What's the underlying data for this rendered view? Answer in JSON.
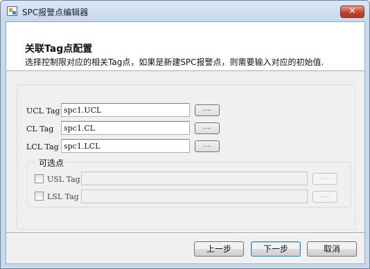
{
  "window": {
    "title": "SPC报警点编辑器",
    "close_label": "✕"
  },
  "header": {
    "title": "关联Tag点配置",
    "description": "选择控制限对应的相关Tag点，如果是新建SPC报警点，则需要输入对应的初始值."
  },
  "tags": [
    {
      "label": "UCL Tag",
      "value": "spc1.UCL",
      "browse_label": "...."
    },
    {
      "label": "CL Tag",
      "value": "spc1.CL",
      "browse_label": "...."
    },
    {
      "label": "LCL Tag",
      "value": "spc1.LCL",
      "browse_label": "...."
    }
  ],
  "optional": {
    "group_label": "可选点",
    "items": [
      {
        "label": "USL Tag",
        "value": "",
        "checked": false,
        "browse_label": "...."
      },
      {
        "label": "LSL Tag",
        "value": "",
        "checked": false,
        "browse_label": "...."
      }
    ]
  },
  "footer": {
    "back_label": "上一步",
    "next_label": "下一步",
    "cancel_label": "取消"
  }
}
